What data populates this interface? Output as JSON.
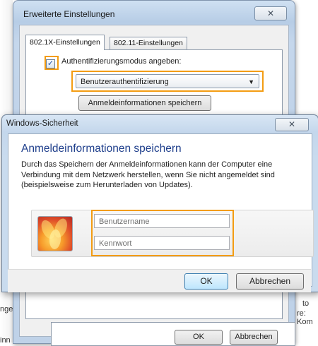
{
  "advanced_window": {
    "title": "Erweiterte Einstellungen",
    "tabs": [
      "802.1X-Einstellungen",
      "802.11-Einstellungen"
    ],
    "checkbox_label": "Authentifizierungsmodus angeben:",
    "checkbox_checked": true,
    "auth_mode_value": "Benutzerauthentifizierung",
    "save_credentials_button": "Anmeldeinformationen speichern",
    "ok_label": "OK",
    "cancel_label": "Abbrechen"
  },
  "background_edges": {
    "left_text_1": "nge",
    "left_text_2": "inn",
    "right_text_1": "to",
    "right_text_2": "re: Kom"
  },
  "security_dialog": {
    "title": "Windows-Sicherheit",
    "heading": "Anmeldeinformationen speichern",
    "description": "Durch das Speichern der Anmeldeinformationen kann der Computer eine Verbindung mit dem Netzwerk herstellen, wenn Sie nicht angemeldet sind (beispielsweise zum Herunterladen von Updates).",
    "username_placeholder": "Benutzername",
    "password_placeholder": "Kennwort",
    "ok_label": "OK",
    "cancel_label": "Abbrechen"
  },
  "colors": {
    "highlight": "#f39c12",
    "heading_blue": "#1f3f8c"
  }
}
